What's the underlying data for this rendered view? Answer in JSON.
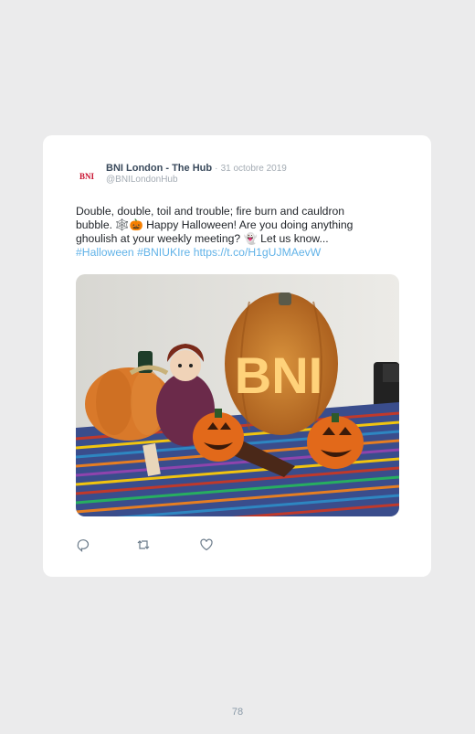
{
  "tweet": {
    "avatar_text": "BNI",
    "author_name": "BNI London - The Hub",
    "separator": "·",
    "date": "31 octobre 2019",
    "handle": "@BNILondonHub",
    "text_line1": "Double, double, toil and trouble; fire burn and cauldron",
    "text_line2": "bubble. 🕸️🎃 Happy Halloween! Are you doing anything",
    "text_line3": "ghoulish at your weekly meeting? 👻 Let us know...",
    "hashtag_halloween": "#Halloween",
    "hashtag_bniuk": "#BNIUKIre",
    "link": "https://t.co/H1gUJMAevW",
    "image_logo_text": "BNI"
  },
  "actions": {
    "reply_icon": "reply-icon",
    "retweet_icon": "retweet-icon",
    "like_icon": "heart-icon"
  },
  "page_number": "78",
  "colors": {
    "background": "#ebebec",
    "card": "#ffffff",
    "link": "#62b3e8",
    "muted": "#a3abb3"
  }
}
